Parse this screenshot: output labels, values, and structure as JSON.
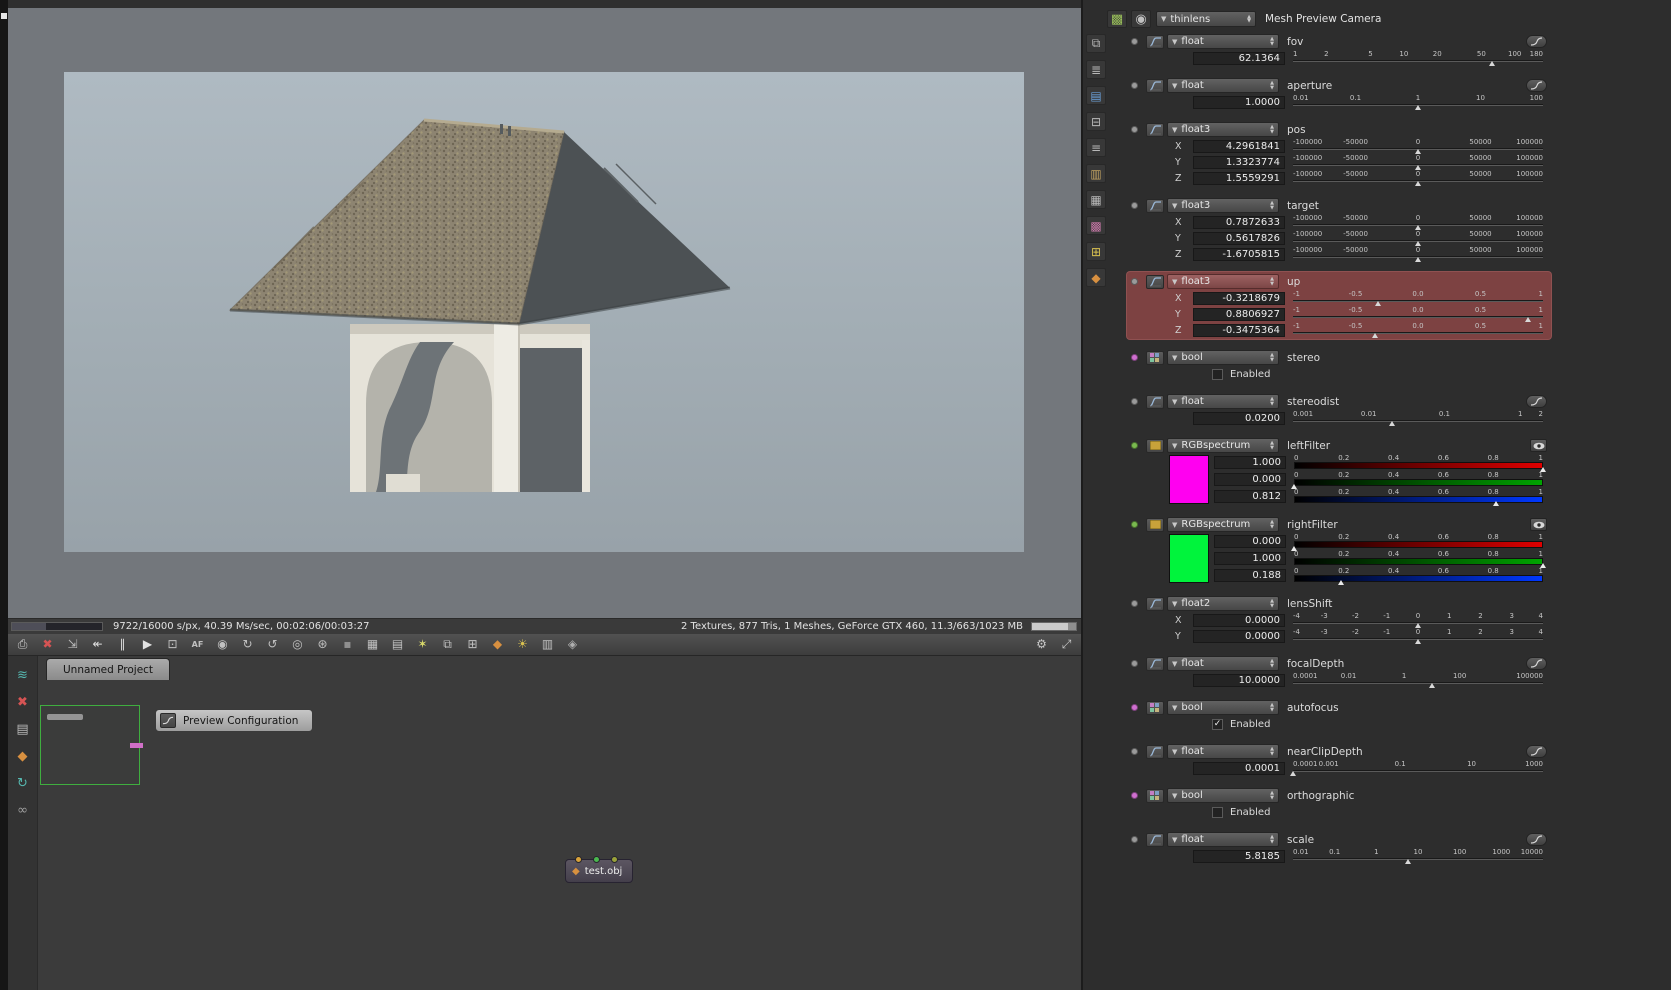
{
  "viewport": {
    "status": {
      "left_text": "9722/16000 s/px, 40.39 Ms/sec, 00:02:06/00:03:27",
      "right_text": "2 Textures, 877 Tris, 1 Meshes, GeForce GTX 460, 11.3/663/1023 MB",
      "left_progress_pct": 38,
      "right_progress_pct": 82
    },
    "toolbar_icons": [
      {
        "name": "save-icon",
        "glyph": "⎙",
        "color": "#cccccc"
      },
      {
        "name": "stop-render-icon",
        "glyph": "✖",
        "color": "#d65454"
      },
      {
        "name": "resize-window-icon",
        "glyph": "⇲",
        "color": "#bbbbbb"
      },
      {
        "name": "skip-to-start-icon",
        "glyph": "↞",
        "color": "#dddddd"
      },
      {
        "name": "pause-icon",
        "glyph": "∥",
        "color": "#dddddd"
      },
      {
        "name": "play-icon",
        "glyph": "▶",
        "color": "#e2e2e2"
      },
      {
        "name": "display-mode-icon",
        "glyph": "⊡",
        "color": "#c0c0c0"
      },
      {
        "name": "af-icon",
        "glyph": "AF",
        "color": "#c0c0c0"
      },
      {
        "name": "camera-icon",
        "glyph": "◉",
        "color": "#c0c0c0"
      },
      {
        "name": "redo-icon",
        "glyph": "↻",
        "color": "#c0c0c0"
      },
      {
        "name": "undo-icon",
        "glyph": "↺",
        "color": "#c0c0c0"
      },
      {
        "name": "world-icon",
        "glyph": "◎",
        "color": "#c0c0c0"
      },
      {
        "name": "world-alt-icon",
        "glyph": "⊛",
        "color": "#c0c0c0"
      },
      {
        "name": "black-frame-icon",
        "glyph": "▪",
        "color": "#8f8f8f"
      },
      {
        "name": "checker-icon",
        "glyph": "▦",
        "color": "#c0c0c0"
      },
      {
        "name": "image-frame-icon",
        "glyph": "▤",
        "color": "#c0c0c0"
      },
      {
        "name": "spark-icon",
        "glyph": "✶",
        "color": "#d8d86a"
      },
      {
        "name": "copy-icon",
        "glyph": "⧉",
        "color": "#c0c0c0"
      },
      {
        "name": "add-node-icon",
        "glyph": "⊞",
        "color": "#c0c0c0"
      },
      {
        "name": "shield-icon",
        "glyph": "◆",
        "color": "#d89040"
      },
      {
        "name": "sun-icon",
        "glyph": "☀",
        "color": "#d8c050"
      },
      {
        "name": "texture-icon",
        "glyph": "▥",
        "color": "#c0c0c0"
      },
      {
        "name": "lock-icon",
        "glyph": "◈",
        "color": "#b0b0b0"
      }
    ],
    "toolbar_right_icons": [
      {
        "name": "wrench-icon",
        "glyph": "⚙",
        "color": "#c8c8c8"
      },
      {
        "name": "fullscreen-icon",
        "glyph": "⤢",
        "color": "#c8c8c8"
      }
    ]
  },
  "node_editor": {
    "tab_label": "Unnamed Project",
    "sidebar_icons": [
      {
        "name": "scene-icon",
        "glyph": "≋",
        "color": "#56b8b0"
      },
      {
        "name": "abort-icon",
        "glyph": "✖",
        "color": "#d65454"
      },
      {
        "name": "document-icon",
        "glyph": "▤",
        "color": "#b8b8b8"
      },
      {
        "name": "droplet-icon",
        "glyph": "◆",
        "color": "#d89040"
      },
      {
        "name": "sync-icon",
        "glyph": "↻",
        "color": "#56b8b0"
      },
      {
        "name": "link-icon",
        "glyph": "∞",
        "color": "#a0a0a0"
      }
    ],
    "preview_button": {
      "label": "Preview Configuration"
    },
    "obj_node": {
      "label": "test.obj",
      "icon_glyph": "◆",
      "port_colors": [
        "#d8a23a",
        "#4ab84e",
        "#9aa23a"
      ]
    }
  },
  "inspector": {
    "header": {
      "type_label": "thinlens",
      "title": "Mesh Preview Camera"
    },
    "header_icons": [
      {
        "name": "node-badge-icon",
        "glyph": "▩",
        "color": "#9ac05a"
      },
      {
        "name": "camera-type-icon",
        "glyph": "◉",
        "color": "#c0c0c0"
      }
    ],
    "side_icons": [
      {
        "name": "pages-icon",
        "glyph": "⧉",
        "color": "#b8b8b8"
      },
      {
        "name": "stack-icon",
        "glyph": "≣",
        "color": "#b8b8b8"
      },
      {
        "name": "screen-icon",
        "glyph": "▤",
        "color": "#6a9fd8"
      },
      {
        "name": "display-icon",
        "glyph": "⊟",
        "color": "#b8b8b8"
      },
      {
        "name": "list-icon",
        "glyph": "≡",
        "color": "#b8b8b8"
      },
      {
        "name": "library-icon",
        "glyph": "▥",
        "color": "#c0a060"
      },
      {
        "name": "photo-icon",
        "glyph": "▦",
        "color": "#b8b8b8"
      },
      {
        "name": "palette-icon",
        "glyph": "▩",
        "color": "#c878a8"
      },
      {
        "name": "grid-icon",
        "glyph": "⊞",
        "color": "#d8c050"
      },
      {
        "name": "material-icon",
        "glyph": "◆",
        "color": "#d89040"
      }
    ],
    "params": [
      {
        "name": "fov",
        "type_label": "float",
        "kind": "float",
        "dot": "#9a9a9a",
        "header_button": "curve",
        "value": "62.1364",
        "slider": {
          "min": 1,
          "max": 180,
          "log": true,
          "value": 62.1364,
          "ticks": [
            "1",
            "2",
            "5",
            "10",
            "20",
            "50",
            "100",
            "180"
          ]
        }
      },
      {
        "name": "aperture",
        "type_label": "float",
        "kind": "float",
        "dot": "#9a9a9a",
        "header_button": "curve",
        "value": "1.0000",
        "slider": {
          "min": 0.01,
          "max": 100,
          "log": true,
          "value": 1,
          "ticks": [
            "0.01",
            "0.1",
            "1",
            "10",
            "100"
          ]
        }
      },
      {
        "name": "pos",
        "type_label": "float3",
        "kind": "vector",
        "dot": "#9a9a9a",
        "rows": [
          {
            "label": "X",
            "value": "4.2961841",
            "slider": {
              "min": -100000,
              "max": 100000,
              "log": false,
              "value": 4.2961841,
              "ticks": [
                "-100000",
                "-50000",
                "0",
                "50000",
                "100000"
              ]
            }
          },
          {
            "label": "Y",
            "value": "1.3323774",
            "slider": {
              "min": -100000,
              "max": 100000,
              "log": false,
              "value": 1.3323774,
              "ticks": [
                "-100000",
                "-50000",
                "0",
                "50000",
                "100000"
              ]
            }
          },
          {
            "label": "Z",
            "value": "1.5559291",
            "slider": {
              "min": -100000,
              "max": 100000,
              "log": false,
              "value": 1.5559291,
              "ticks": [
                "-100000",
                "-50000",
                "0",
                "50000",
                "100000"
              ]
            }
          }
        ]
      },
      {
        "name": "target",
        "type_label": "float3",
        "kind": "vector",
        "dot": "#9a9a9a",
        "rows": [
          {
            "label": "X",
            "value": "0.7872633",
            "slider": {
              "min": -100000,
              "max": 100000,
              "log": false,
              "value": 0.7872633,
              "ticks": [
                "-100000",
                "-50000",
                "0",
                "50000",
                "100000"
              ]
            }
          },
          {
            "label": "Y",
            "value": "0.5617826",
            "slider": {
              "min": -100000,
              "max": 100000,
              "log": false,
              "value": 0.5617826,
              "ticks": [
                "-100000",
                "-50000",
                "0",
                "50000",
                "100000"
              ]
            }
          },
          {
            "label": "Z",
            "value": "-1.6705815",
            "slider": {
              "min": -100000,
              "max": 100000,
              "log": false,
              "value": -1.6705815,
              "ticks": [
                "-100000",
                "-50000",
                "0",
                "50000",
                "100000"
              ]
            }
          }
        ]
      },
      {
        "name": "up",
        "type_label": "float3",
        "kind": "vector",
        "dot": "#9a9a9a",
        "highlight": true,
        "rows": [
          {
            "label": "X",
            "value": "-0.3218679",
            "slider": {
              "min": -1,
              "max": 1,
              "log": false,
              "value": -0.3218679,
              "ticks": [
                "-1",
                "-0.5",
                "0.0",
                "0.5",
                "1"
              ]
            }
          },
          {
            "label": "Y",
            "value": "0.8806927",
            "slider": {
              "min": -1,
              "max": 1,
              "log": false,
              "value": 0.8806927,
              "ticks": [
                "-1",
                "-0.5",
                "0.0",
                "0.5",
                "1"
              ]
            }
          },
          {
            "label": "Z",
            "value": "-0.3475364",
            "slider": {
              "min": -1,
              "max": 1,
              "log": false,
              "value": -0.3475364,
              "ticks": [
                "-1",
                "-0.5",
                "0.0",
                "0.5",
                "1"
              ]
            }
          }
        ]
      },
      {
        "name": "stereo",
        "type_label": "bool",
        "kind": "bool",
        "dot": "#cf6fcf",
        "checked": false,
        "check_label": "Enabled"
      },
      {
        "name": "stereodist",
        "type_label": "float",
        "kind": "float",
        "dot": "#9a9a9a",
        "header_button": "curve",
        "value": "0.0200",
        "slider": {
          "min": 0.001,
          "max": 2,
          "log": true,
          "value": 0.02,
          "ticks": [
            "0.001",
            "0.01",
            "0.1",
            "1",
            "2"
          ]
        }
      },
      {
        "name": "leftFilter",
        "type_label": "RGBspectrum",
        "kind": "rgb",
        "dot": "#79b94f",
        "header_button": "eye",
        "swatch": "#ff00f0",
        "ticks": [
          "0",
          "0.2",
          "0.4",
          "0.6",
          "0.8",
          "1"
        ],
        "rows": [
          {
            "value": "1.000",
            "v": 1,
            "bar": "#e00000"
          },
          {
            "value": "0.000",
            "v": 0,
            "bar": "#00a400"
          },
          {
            "value": "0.812",
            "v": 0.812,
            "bar": "#0038ff"
          }
        ]
      },
      {
        "name": "rightFilter",
        "type_label": "RGBspectrum",
        "kind": "rgb",
        "dot": "#79b94f",
        "header_button": "eye",
        "swatch": "#00f43c",
        "ticks": [
          "0",
          "0.2",
          "0.4",
          "0.6",
          "0.8",
          "1"
        ],
        "rows": [
          {
            "value": "0.000",
            "v": 0,
            "bar": "#e00000"
          },
          {
            "value": "1.000",
            "v": 1,
            "bar": "#00a400"
          },
          {
            "value": "0.188",
            "v": 0.188,
            "bar": "#0038ff"
          }
        ]
      },
      {
        "name": "lensShift",
        "type_label": "float2",
        "kind": "vector",
        "dot": "#9a9a9a",
        "rows": [
          {
            "label": "X",
            "value": "0.0000",
            "slider": {
              "min": -4,
              "max": 4,
              "log": false,
              "value": 0,
              "ticks": [
                "-4",
                "-3",
                "-2",
                "-1",
                "0",
                "1",
                "2",
                "3",
                "4"
              ]
            }
          },
          {
            "label": "Y",
            "value": "0.0000",
            "slider": {
              "min": -4,
              "max": 4,
              "log": false,
              "value": 0,
              "ticks": [
                "-4",
                "-3",
                "-2",
                "-1",
                "0",
                "1",
                "2",
                "3",
                "4"
              ]
            }
          }
        ]
      },
      {
        "name": "focalDepth",
        "type_label": "float",
        "kind": "float",
        "dot": "#9a9a9a",
        "header_button": "curve",
        "value": "10.0000",
        "slider": {
          "min": 0.0001,
          "max": 100000,
          "log": true,
          "value": 10,
          "ticks": [
            "0.0001",
            "0.01",
            "1",
            "100",
            "100000"
          ]
        }
      },
      {
        "name": "autofocus",
        "type_label": "bool",
        "kind": "bool",
        "dot": "#cf6fcf",
        "checked": true,
        "check_label": "Enabled"
      },
      {
        "name": "nearClipDepth",
        "type_label": "float",
        "kind": "float",
        "dot": "#9a9a9a",
        "header_button": "curve",
        "value": "0.0001",
        "slider": {
          "min": 0.0001,
          "max": 1000,
          "log": true,
          "value": 0.0001,
          "ticks": [
            "0.0001",
            "0.001",
            "0.1",
            "10",
            "1000"
          ]
        }
      },
      {
        "name": "orthographic",
        "type_label": "bool",
        "kind": "bool",
        "dot": "#cf6fcf",
        "checked": false,
        "check_label": "Enabled"
      },
      {
        "name": "scale",
        "type_label": "float",
        "kind": "float",
        "dot": "#9a9a9a",
        "header_button": "curve",
        "value": "5.8185",
        "slider": {
          "min": 0.01,
          "max": 10000,
          "log": true,
          "value": 5.8185,
          "ticks": [
            "0.01",
            "0.1",
            "1",
            "10",
            "100",
            "1000",
            "10000"
          ]
        }
      }
    ]
  }
}
